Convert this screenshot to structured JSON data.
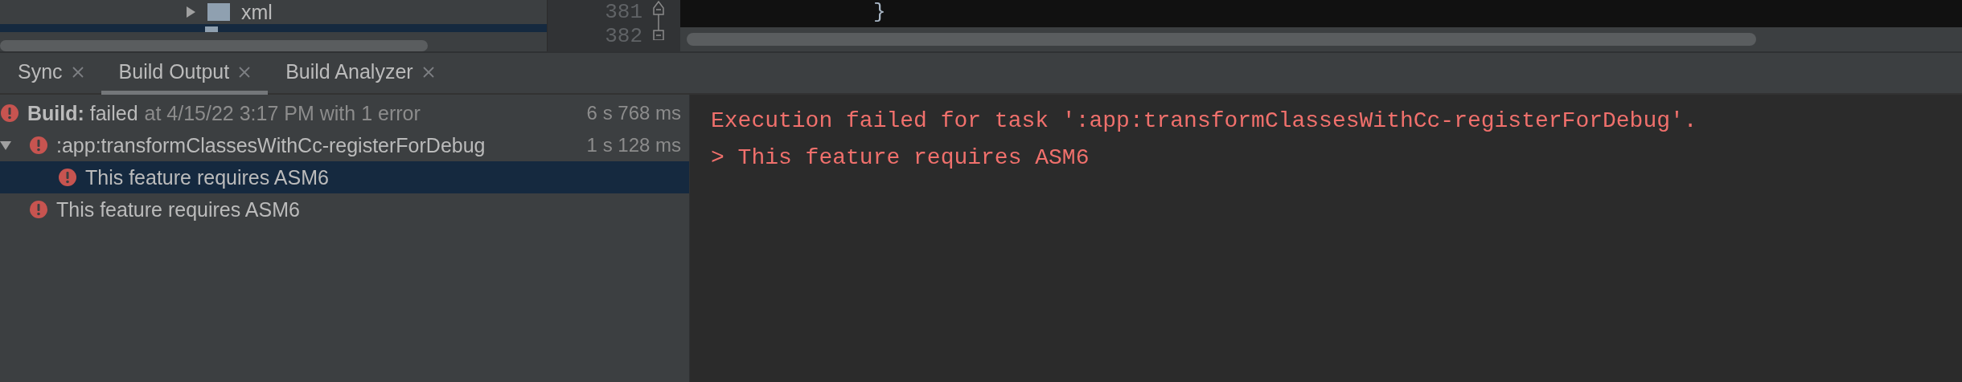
{
  "project_tree": {
    "items": [
      {
        "label": "xml",
        "expanded": false,
        "selected": false
      },
      {
        "selected": true
      }
    ]
  },
  "editor": {
    "line_numbers": [
      "381",
      "382"
    ],
    "lines": [
      "}"
    ]
  },
  "tabs": [
    {
      "label": "Sync",
      "selected": false
    },
    {
      "label": "Build Output",
      "selected": true
    },
    {
      "label": "Build Analyzer",
      "selected": false
    }
  ],
  "build_tree": [
    {
      "label": "**Build:** failed",
      "detail": "at 4/15/22 3:17 PM with 1 error",
      "time": "6 s 768 ms",
      "error": true,
      "selected": false,
      "children": [
        {
          "label": ":app:transformClassesWithCc-registerForDebug",
          "time": "1 s 128 ms",
          "error": true,
          "selected": false,
          "expanded": true,
          "children": [
            {
              "label": "This feature requires ASM6",
              "error": true,
              "selected": true
            }
          ]
        },
        {
          "label": "This feature requires ASM6",
          "error": true,
          "selected": false
        }
      ]
    }
  ],
  "console": {
    "lines": [
      "Execution failed for task ':app:transformClassesWithCc-registerForDebug'.",
      "> This feature requires ASM6"
    ]
  }
}
